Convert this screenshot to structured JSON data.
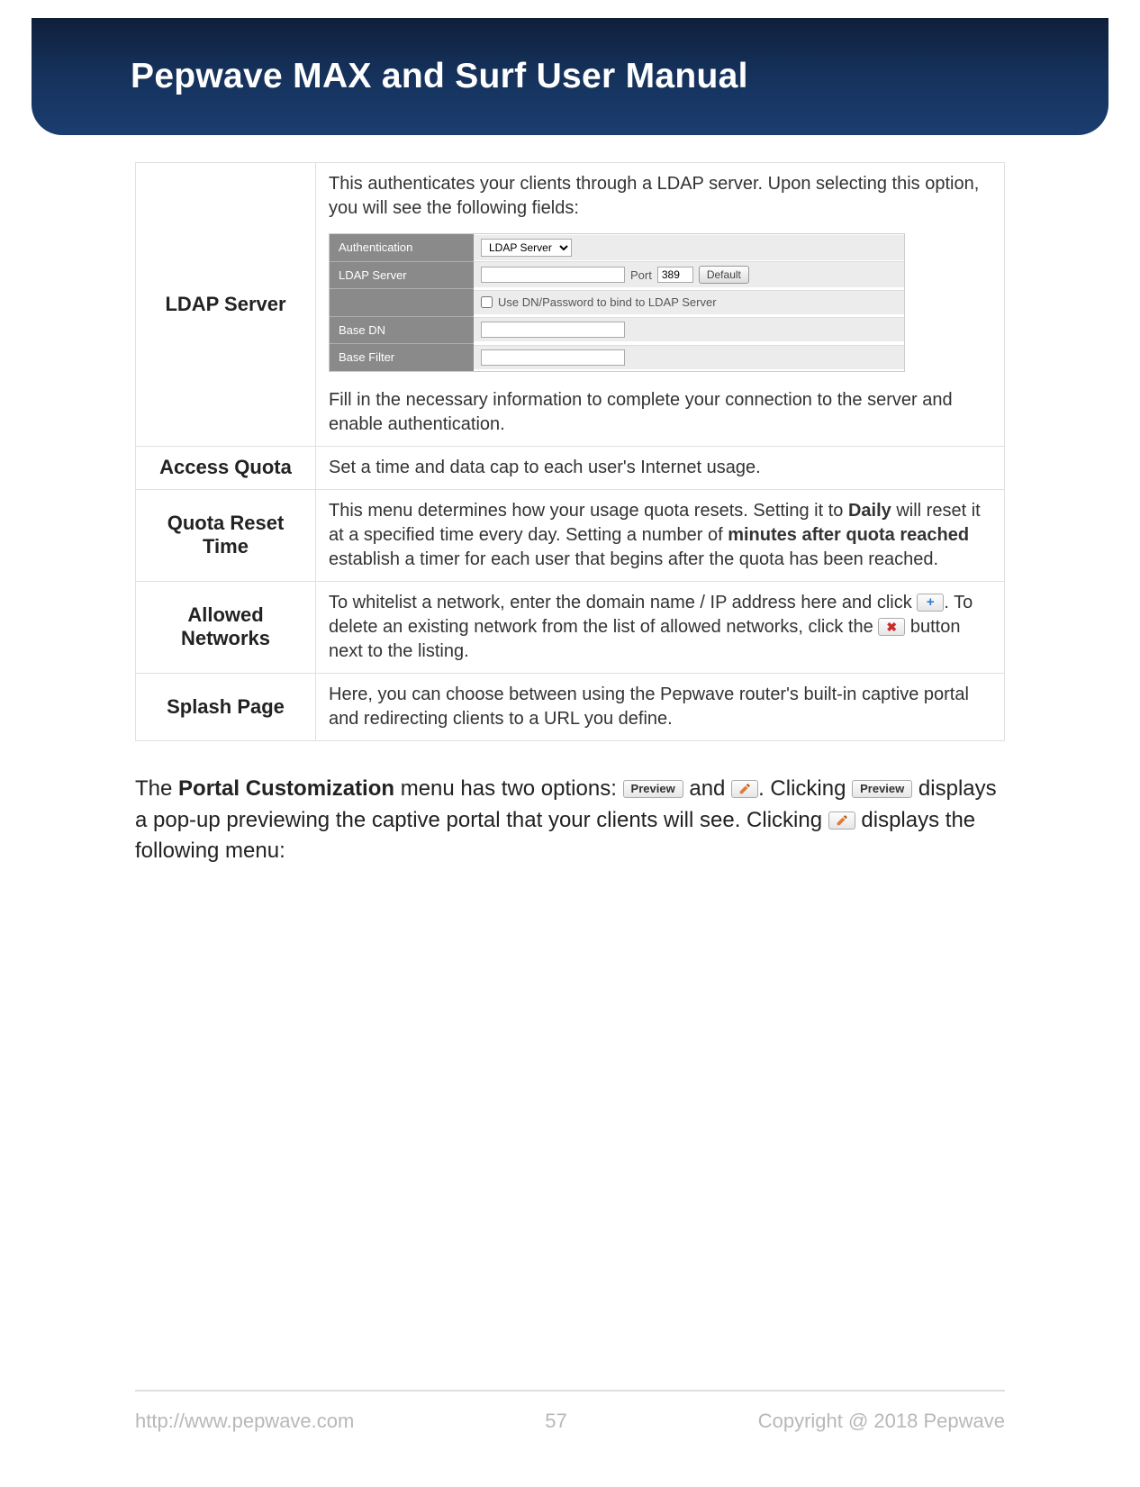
{
  "header": {
    "title": "Pepwave MAX and Surf User Manual"
  },
  "table": {
    "ldap": {
      "label": "LDAP Server",
      "intro": "This authenticates your clients through a LDAP server. Upon selecting this option, you will see the following fields:",
      "outro": "Fill in the necessary information to complete your connection to the server and enable authentication.",
      "form": {
        "rows": {
          "auth_label": "Authentication",
          "auth_value": "LDAP Server",
          "server_label": "LDAP Server",
          "port_label": "Port",
          "port_value": "389",
          "default_btn": "Default",
          "checkbox_label": "Use DN/Password to bind to LDAP Server",
          "basedn_label": "Base DN",
          "basefilter_label": "Base Filter"
        }
      }
    },
    "access_quota": {
      "label": "Access Quota",
      "desc": "Set a time and data cap to each user's Internet usage."
    },
    "quota_reset": {
      "label": "Quota Reset Time",
      "desc_prefix": "This menu determines how your usage quota resets. Setting it to ",
      "bold1": "Daily",
      "desc_mid": " will reset it at a specified time every day. Setting a number of ",
      "bold2": "minutes after quota reached",
      "desc_suffix": " establish a timer for each user that begins after the quota has been reached."
    },
    "allowed": {
      "label": "Allowed Networks",
      "line1_before": "To whitelist a network, enter the domain name / IP address here and click ",
      "line1_after": ".",
      "line2_before": "To delete an existing network from the list of allowed networks, click the ",
      "line2_after": " button next to the listing."
    },
    "splash": {
      "label": "Splash Page",
      "desc": "Here, you can choose between using the Pepwave router's built-in captive portal and redirecting clients to a URL you define."
    }
  },
  "paragraph": {
    "p1": "The ",
    "p1_bold": "Portal Customization",
    "p1_after": " menu has two options: ",
    "preview_label": "Preview",
    "and": " and ",
    "p1_tail": ". Clicking ",
    "p2": " displays a pop-up previewing the captive portal that your clients will see. Clicking ",
    "p3": " displays the following menu:"
  },
  "footer": {
    "url": "http://www.pepwave.com",
    "page": "57",
    "copyright": "Copyright @ 2018 Pepwave"
  },
  "icons": {
    "plus": "+",
    "x": "✖"
  }
}
